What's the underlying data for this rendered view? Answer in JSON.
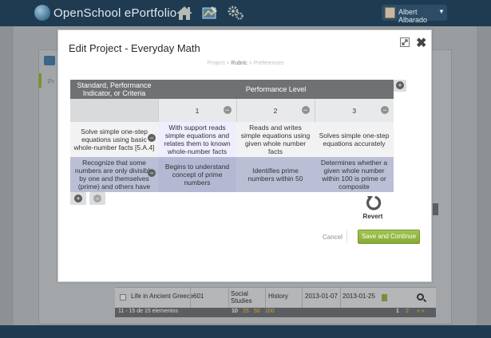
{
  "app": {
    "title": "OpenSchool ePortfolio",
    "user_name": "Albert Albarado",
    "user_caret": "▼"
  },
  "background": {
    "panel_prefix": "Pr",
    "row": {
      "title": "Life in Ancient Greece",
      "code": "601",
      "subject": "Social Studies",
      "course": "History",
      "start_date": "2013-01-07",
      "end_date": "2013-01-25"
    },
    "footer": {
      "range_text": "11 - 15 de 15 elementos",
      "page_sizes": [
        "10",
        "25",
        "50",
        "100"
      ],
      "pages": [
        "1",
        "2"
      ],
      "arrows": "» »"
    }
  },
  "modal": {
    "title": "Edit Project - Everyday Math",
    "steps": [
      "Project",
      "Rubric",
      "Preferences"
    ],
    "step_separator": ">",
    "active_step_index": 1,
    "rubric": {
      "criteria_header": "Standard, Performance Indicator, or Criteria",
      "performance_header": "Performance Level",
      "levels": [
        "1",
        "2",
        "3"
      ],
      "rows": [
        {
          "criterion": "Solve simple one-step equations using basic whole-number facts [5.A.4]",
          "cells": [
            "With support reads simple equations and relates them to known whole-number facts",
            "Reads and writes simple equations using given whole number facts",
            "Solves simple one-step equations accurately"
          ]
        },
        {
          "criterion": "Recognize that some numbers are only divisible by one and themselves (prime) and others have",
          "cells": [
            "Begins to understand concept of prime numbers",
            "Identifies prime numbers within 50",
            "Determines whether a given whole number within 100 is prime or composite"
          ]
        }
      ]
    },
    "revert_label": "Revert",
    "cancel_label": "Cancel",
    "save_label": "Save and Continue",
    "icons": {
      "plus": "+",
      "minus": "−",
      "close": "✖"
    }
  },
  "colors": {
    "topbar": "#1e3b52",
    "save_button": "#8fb43c",
    "rubric_header": "#6f7173",
    "selected_row": "#babfd6"
  }
}
